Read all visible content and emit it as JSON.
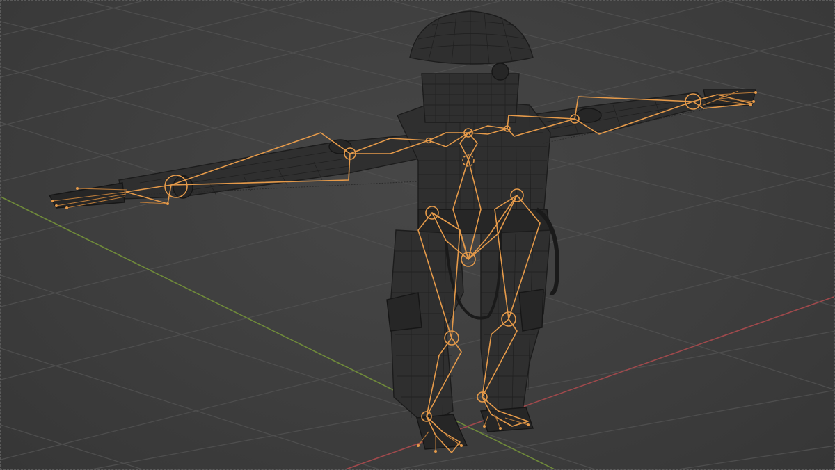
{
  "viewport": {
    "mode": "3d-viewport",
    "object": "character-rig",
    "display": "wireframe-with-armature",
    "colors": {
      "background": "#3d3d3d",
      "grid": "#4e4e4e",
      "axis_x": "#a0494c",
      "axis_y": "#6f8a3a",
      "armature": "#e59a4a",
      "mesh_wire": "#1a1a1a"
    }
  }
}
